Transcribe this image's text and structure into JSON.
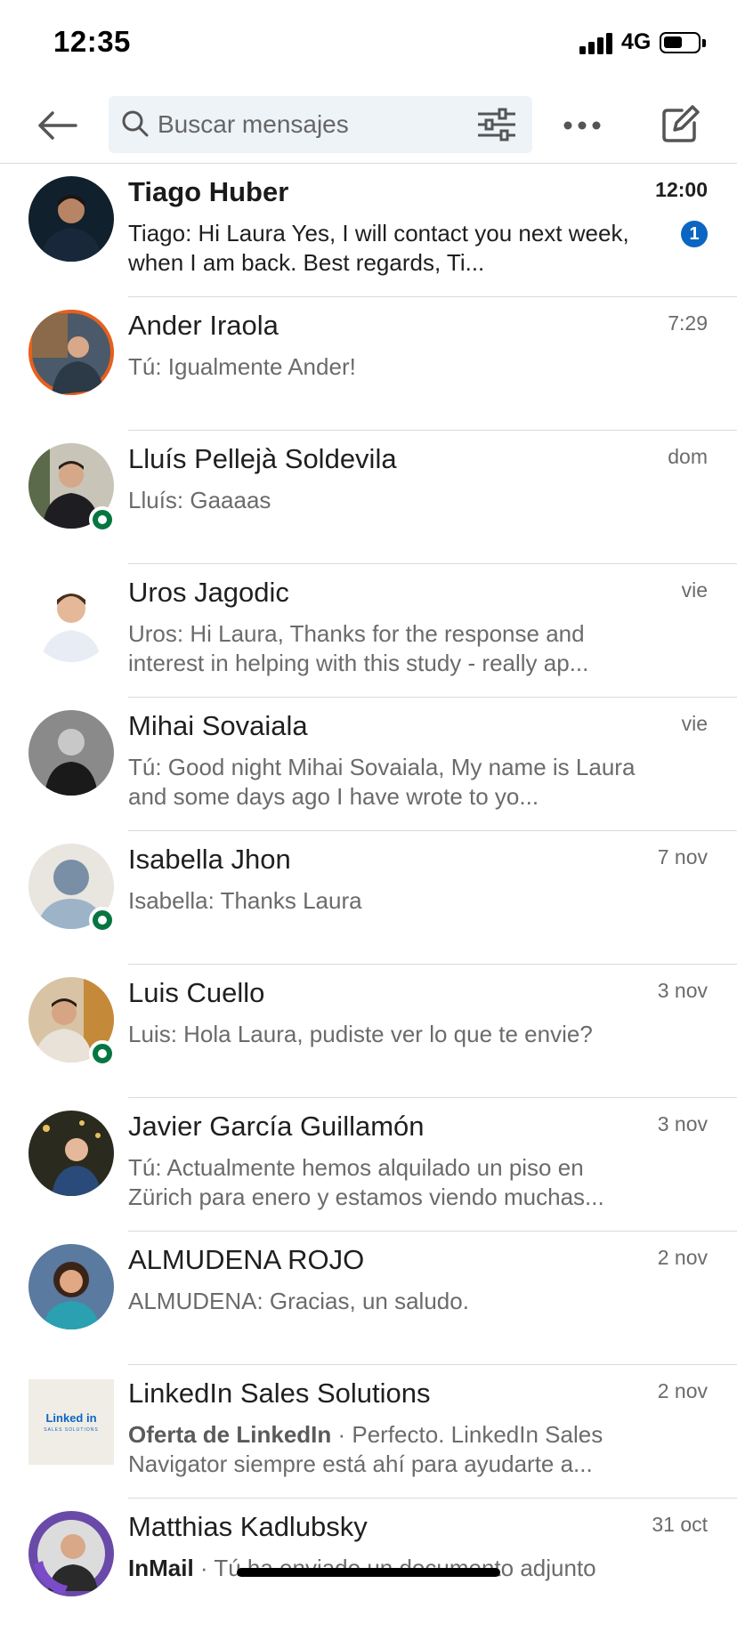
{
  "status_bar": {
    "time": "12:35",
    "network": "4G",
    "battery_level": 0.55
  },
  "header": {
    "back_icon": "arrow-left-icon",
    "search": {
      "placeholder": "Buscar mensajes",
      "icon": "search-icon"
    },
    "filter_icon": "sliders-icon",
    "more_icon": "ellipsis-icon",
    "compose_icon": "compose-icon"
  },
  "colors": {
    "accent": "#0a66c2",
    "presence": "#057642",
    "search_bg": "#eef3f8",
    "divider": "#dadada"
  },
  "conversations": [
    {
      "name": "Tiago Huber",
      "time": "12:00",
      "preview": "Tiago: Hi Laura Yes, I will contact you next week, when I am back.  Best regards,  Ti...",
      "unread_count": "1",
      "online": false
    },
    {
      "name": "Ander Iraola",
      "time": "7:29",
      "preview": "Tú: Igualmente Ander!",
      "online": false
    },
    {
      "name": "Lluís Pellejà Soldevila",
      "time": "dom",
      "preview": "Lluís: Gaaaas",
      "online": true
    },
    {
      "name": "Uros Jagodic",
      "time": "vie",
      "preview": "Uros: Hi Laura, Thanks for the response and interest in helping with this study - really ap...",
      "online": false
    },
    {
      "name": "Mihai Sovaiala",
      "time": "vie",
      "preview": "Tú: Good night Mihai Sovaiala,  My name is Laura and some days ago I have wrote to yo...",
      "online": false
    },
    {
      "name": "Isabella Jhon",
      "time": "7 nov",
      "preview": "Isabella: Thanks Laura",
      "online": true
    },
    {
      "name": "Luis Cuello",
      "time": "3 nov",
      "preview": "Luis: Hola Laura, pudiste ver lo que te envie?",
      "online": true
    },
    {
      "name": "Javier García Guillamón",
      "time": "3 nov",
      "preview": "Tú: Actualmente hemos alquilado un piso en Zürich para enero y estamos viendo muchas...",
      "online": false
    },
    {
      "name": "ALMUDENA ROJO",
      "time": "2 nov",
      "preview": "ALMUDENA: Gracias, un saludo.",
      "online": false
    },
    {
      "name": "LinkedIn Sales Solutions",
      "time": "2 nov",
      "tag": "Oferta de LinkedIn",
      "tag_separator": " · ",
      "preview": "Perfecto. LinkedIn Sales Navigator siempre está ahí para ayudarte a...",
      "online": false,
      "logo_text": "Linked in",
      "logo_subtext": "SALES SOLUTIONS"
    },
    {
      "name": "Matthias Kadlubsky",
      "time": "31 oct",
      "tag": "InMail",
      "tag_separator": " · ",
      "preview": "Tú ha enviado un documento adjunto",
      "online": false
    }
  ]
}
